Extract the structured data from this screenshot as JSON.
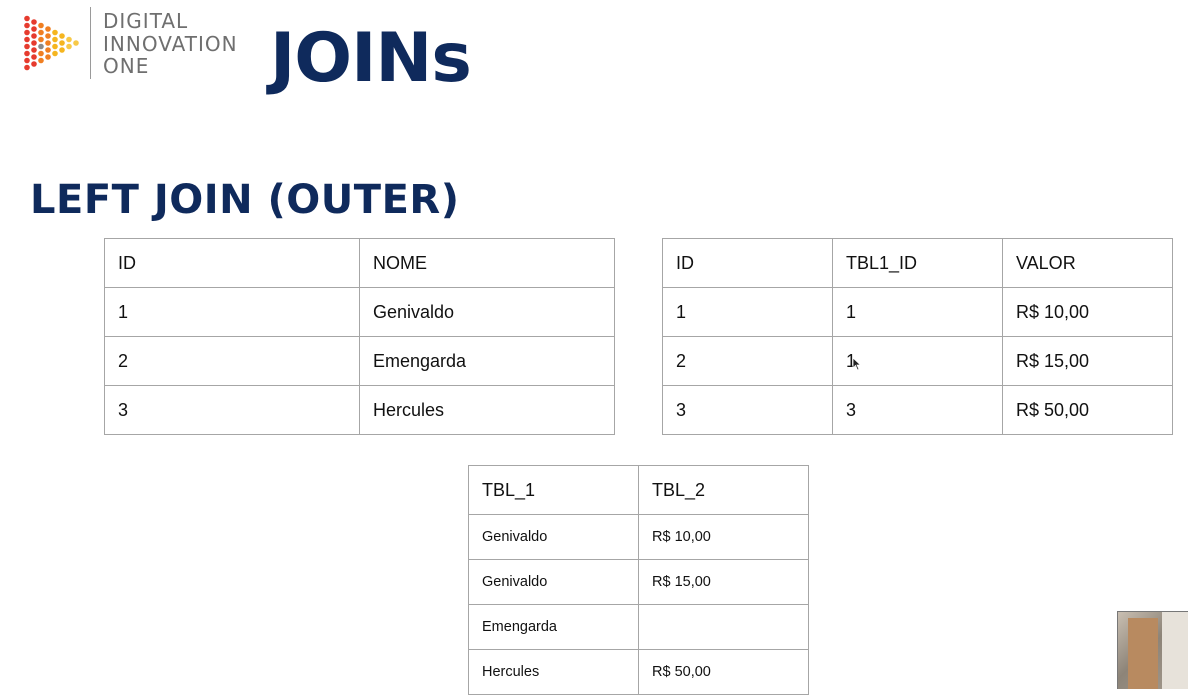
{
  "logo": {
    "line1": "DIGITAL",
    "line2": "INNOVATION",
    "line3": "ONE",
    "dot_colors": [
      "#e63b2e",
      "#f07f22",
      "#f5b51f",
      "#f7c948",
      "#8a8a8a"
    ]
  },
  "title": "JOINs",
  "subtitle": "LEFT JOIN (OUTER)",
  "colors": {
    "title": "#0f2a5c",
    "border": "#a6a6a6",
    "logo_text": "#6f6f6f"
  },
  "table1": {
    "headers": [
      "ID",
      "NOME"
    ],
    "rows": [
      [
        "1",
        "Genivaldo"
      ],
      [
        "2",
        "Emengarda"
      ],
      [
        "3",
        "Hercules"
      ]
    ]
  },
  "table2": {
    "headers": [
      "ID",
      "TBL1_ID",
      "VALOR"
    ],
    "rows": [
      [
        "1",
        "1",
        "R$ 10,00"
      ],
      [
        "2",
        "1",
        "R$ 15,00"
      ],
      [
        "3",
        "3",
        "R$ 50,00"
      ]
    ]
  },
  "table3": {
    "headers": [
      "TBL_1",
      "TBL_2"
    ],
    "rows": [
      [
        "Genivaldo",
        "R$ 10,00"
      ],
      [
        "Genivaldo",
        "R$ 15,00"
      ],
      [
        "Emengarda",
        ""
      ],
      [
        "Hercules",
        "R$ 50,00"
      ]
    ]
  }
}
